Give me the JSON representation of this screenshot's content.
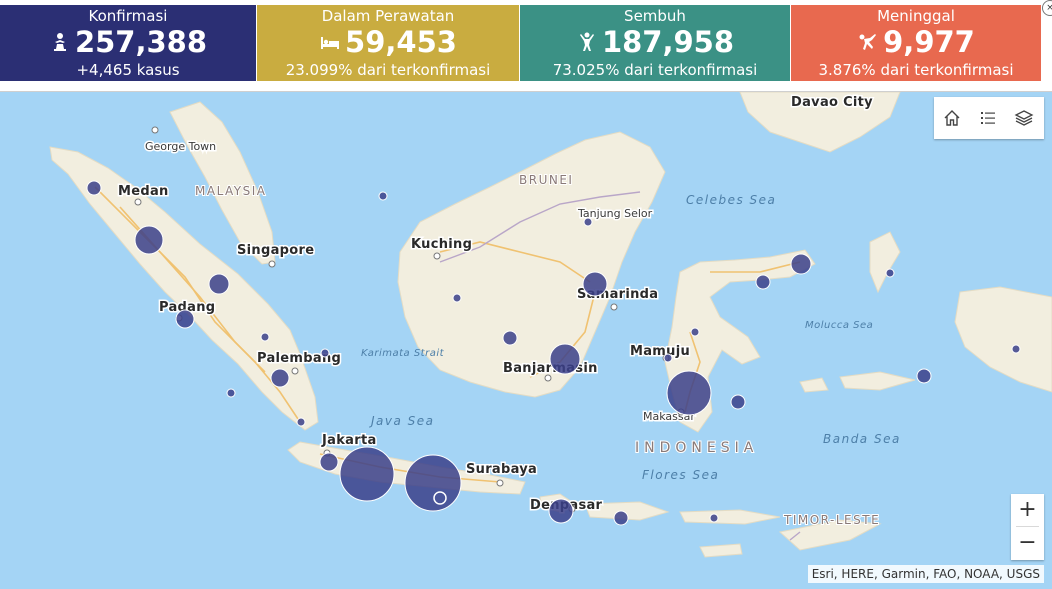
{
  "stats": [
    {
      "label": "Konfirmasi",
      "value": "257,388",
      "sub": "+4,465 kasus",
      "color": "#2b2f74",
      "icon": "person-icon"
    },
    {
      "label": "Dalam Perawatan",
      "value": "59,453",
      "sub": "23.099% dari terkonfirmasi",
      "color": "#c9ac40",
      "icon": "bed-icon"
    },
    {
      "label": "Sembuh",
      "value": "187,958",
      "sub": "73.025% dari terkonfirmasi",
      "color": "#3b9185",
      "icon": "recovered-icon"
    },
    {
      "label": "Meninggal",
      "value": "9,977",
      "sub": "3.876% dari terkonfirmasi",
      "color": "#e8694f",
      "icon": "falling-person-icon"
    }
  ],
  "map": {
    "cities": {
      "davao": "Davao City",
      "georgetown": "George Town",
      "medan": "Medan",
      "malaysia": "MALAYSIA",
      "brunei": "BRUNEI",
      "celebes": "Celebes Sea",
      "tanjung": "Tanjung Selor",
      "kuching": "Kuching",
      "singapore": "Singapore",
      "samarinda": "Samarinda",
      "padang": "Padang",
      "molucca": "Molucca Sea",
      "karimata": "Karimata Strait",
      "mamuju": "Mamuju",
      "palembang": "Palembang",
      "banjarmasin": "Banjarmasin",
      "java_sea": "Java Sea",
      "makassar": "Makassar",
      "jakarta": "Jakarta",
      "indonesia": "INDONESIA",
      "banda": "Banda Sea",
      "surabaya": "Surabaya",
      "flores": "Flores Sea",
      "denpasar": "Denpasar",
      "timor": "TIMOR-LESTE"
    },
    "attribution": "Esri, HERE, Garmin, FAO, NOAA, USGS",
    "colors": {
      "sea": "#a4d4f5",
      "land": "#f2eedf",
      "marker": "#3b3f8a",
      "road": "#f0c271"
    }
  },
  "widgets": {
    "home": "home-icon",
    "legend": "legend-list-icon",
    "layers": "layers-icon"
  },
  "zoom": {
    "in": "+",
    "out": "−"
  },
  "close": "×"
}
